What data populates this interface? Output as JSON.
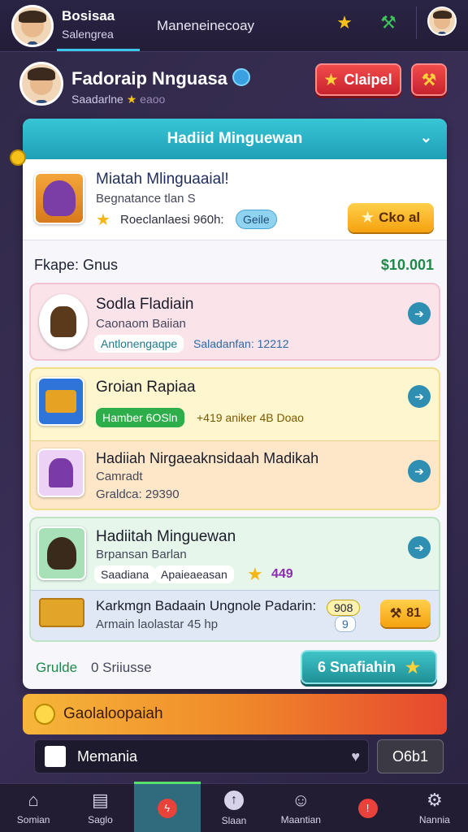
{
  "topbar": {
    "name": "Bosisaa",
    "sub": "Salengrea",
    "tab": "Maneneinecoay",
    "icons": [
      "medal-icon",
      "hammer-icon",
      "character-icon"
    ]
  },
  "profile": {
    "name": "Fadoraip Nnguasa",
    "sub": "Saadarlne",
    "sub_extra": "eaoo",
    "claim_label": "Claipel",
    "tools_icon": "hammer-icon"
  },
  "panel": {
    "header": "Hadiid Minguewan",
    "featured": {
      "title": "Miatah Mlinguaaial!",
      "sub": "Begnatance tlan S",
      "reward_text": "Roeclanlaesi 960h:",
      "pill": "Geile",
      "button": "Cko al"
    },
    "section_label": "Fkape: Gnus",
    "section_value": "$10.001",
    "cards": [
      {
        "title": "Sodla Fladiain",
        "sub": "Caonaom Baiian",
        "tag1": "Antlonengaqpe",
        "tag2": "Saladanfan: 12212"
      },
      {
        "title": "Groian Rapiaa",
        "pill": "Hamber 6OSln",
        "tag2": "+419 aniker 4B Doao"
      },
      {
        "title": "Hadiiah Nirgaeaknsidaah Madikah",
        "sub": "Camradt",
        "tag1": "Graldca: 29390"
      },
      {
        "title": "Hadiitah Minguewan",
        "sub": "Brpansan Barlan",
        "tag1": "Saadiana",
        "tag2": "Apaieaeasan",
        "score": "449"
      },
      {
        "title": "Karkmgn Badaain Ungnole Padarin:",
        "sub": "Armain laolastar 45 hp",
        "counter": "908",
        "counter2": "9",
        "button": "81"
      }
    ],
    "footer_label": "Grulde",
    "footer_value": "0 Sriiusse",
    "footer_button": "6 Snafiahin"
  },
  "banner": {
    "text": "Gaolaloopaiah"
  },
  "chat": {
    "text": "Memania",
    "button": "O6b1"
  },
  "bottomnav": [
    {
      "label": "Somian",
      "icon": "home-icon"
    },
    {
      "label": "Saglo",
      "icon": "calendar-icon"
    },
    {
      "label": "",
      "icon": "lightning-icon"
    },
    {
      "label": "Slaan",
      "icon": "upload-icon"
    },
    {
      "label": "Maantian",
      "icon": "people-icon"
    },
    {
      "label": "",
      "icon": "alert-icon"
    },
    {
      "label": "Nannia",
      "icon": "gear-icon"
    }
  ],
  "colors": {
    "accent_teal": "#1f9fb6",
    "accent_red": "#c7232f",
    "accent_orange": "#f5a20f",
    "positive_green": "#1e8a4a"
  }
}
